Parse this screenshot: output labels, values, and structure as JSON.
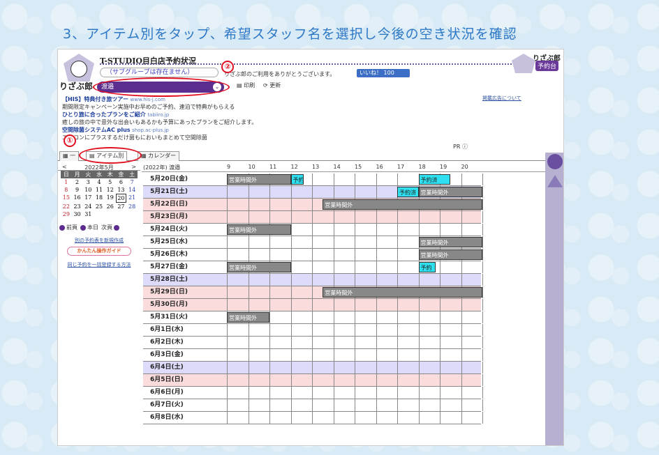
{
  "heading": "3、アイテム別をタップ、希望スタッフ名を選択し今後の空き状況を確認",
  "header": {
    "shop_title": "T-STUDIO目白店予約状況",
    "subgroup_placeholder": "（サブグループは存在ません）",
    "thanks": "りざぶ郎のご利用をありがとうございます。",
    "like_label": "いいね！ 100",
    "logo_text": "りざぶ郎",
    "logo_right_text": "りざぶ郎",
    "logo_right_badge": "予約台"
  },
  "staff_select": {
    "value": "渡邉"
  },
  "toolbar": {
    "print_label": "印刷",
    "refresh_label": "更新"
  },
  "badges": {
    "one": "①",
    "two": "②"
  },
  "ads": [
    {
      "title": "【HIS】特典付き旅ツアー",
      "url": "www.his-j.com",
      "desc": "期間限定キャンペーン実施中お早めのご予約、連泊で特典がもらえる"
    },
    {
      "title": "ひとり旅に合ったプランをご紹介",
      "url": "tabiiro.jp",
      "desc": "癒しの旅の中で意外な出会いもあるかも予算にあったプランをご紹介します。"
    },
    {
      "title": "空間除菌システムAC plus",
      "url": "shop.ac-plus.jp",
      "desc": "エアコンにプラスするだけ菌もにおいもまとめて空間除菌"
    }
  ],
  "ad_info_link": "掲載広告について",
  "pr_label": "PR ⓘ",
  "tabs": [
    {
      "label": "一"
    },
    {
      "label": "アイテム別"
    },
    {
      "label": "カレンダー"
    }
  ],
  "calendar": {
    "prev": "<",
    "month": "2022年5月",
    "next": ">",
    "weekdays": [
      "日",
      "月",
      "火",
      "水",
      "木",
      "金",
      "土"
    ],
    "days": [
      "1",
      "2",
      "3",
      "4",
      "5",
      "6",
      "7",
      "8",
      "9",
      "10",
      "11",
      "12",
      "13",
      "14",
      "15",
      "16",
      "17",
      "18",
      "19",
      "20",
      "21",
      "22",
      "23",
      "24",
      "25",
      "26",
      "27",
      "28",
      "29",
      "30",
      "31"
    ]
  },
  "nav": {
    "prev_label": "前頁",
    "today_label": "本日",
    "next_label": "次頁"
  },
  "side_links": {
    "new_table": "別の予約表を新規作成",
    "guide": "かんたん操作ガイド",
    "bulk": "同じ予約を一括登録する方法"
  },
  "schedule": {
    "caption": "(2022年) 渡邉",
    "hours": [
      "9",
      "10",
      "11",
      "12",
      "13",
      "14",
      "15",
      "16",
      "17",
      "18",
      "19",
      "20"
    ],
    "rows": [
      {
        "label": "5月20日(金)",
        "kind": "weekday",
        "blocks": [
          {
            "text": "営業時間外",
            "start": 9,
            "end": 12,
            "type": "out"
          },
          {
            "text": "予約",
            "start": 12,
            "end": 12.6,
            "type": "booked"
          },
          {
            "text": "予約済",
            "start": 18,
            "end": 19.5,
            "type": "booked"
          }
        ]
      },
      {
        "label": "5月21日(土)",
        "kind": "sat",
        "blocks": [
          {
            "text": "予約済",
            "start": 17,
            "end": 18,
            "type": "booked"
          },
          {
            "text": "営業時間外",
            "start": 18,
            "end": 21,
            "type": "out"
          }
        ]
      },
      {
        "label": "5月22日(日)",
        "kind": "sun",
        "blocks": [
          {
            "text": "営業時間外",
            "start": 13.5,
            "end": 21,
            "type": "out"
          }
        ]
      },
      {
        "label": "5月23日(月)",
        "kind": "sun",
        "blocks": []
      },
      {
        "label": "5月24日(火)",
        "kind": "weekday",
        "blocks": [
          {
            "text": "営業時間外",
            "start": 9,
            "end": 12,
            "type": "out"
          }
        ]
      },
      {
        "label": "5月25日(水)",
        "kind": "weekday",
        "blocks": [
          {
            "text": "営業時間外",
            "start": 18,
            "end": 21,
            "type": "out"
          }
        ]
      },
      {
        "label": "5月26日(木)",
        "kind": "weekday",
        "blocks": [
          {
            "text": "営業時間外",
            "start": 18,
            "end": 21,
            "type": "out"
          }
        ]
      },
      {
        "label": "5月27日(金)",
        "kind": "weekday",
        "blocks": [
          {
            "text": "営業時間外",
            "start": 9,
            "end": 12,
            "type": "out"
          },
          {
            "text": "予約",
            "start": 18,
            "end": 18.8,
            "type": "booked"
          }
        ]
      },
      {
        "label": "5月28日(土)",
        "kind": "sat",
        "blocks": []
      },
      {
        "label": "5月29日(日)",
        "kind": "sun",
        "blocks": [
          {
            "text": "営業時間外",
            "start": 13.5,
            "end": 21,
            "type": "out"
          }
        ]
      },
      {
        "label": "5月30日(月)",
        "kind": "sun",
        "blocks": []
      },
      {
        "label": "5月31日(火)",
        "kind": "weekday",
        "blocks": [
          {
            "text": "営業時間外",
            "start": 9,
            "end": 11,
            "type": "out"
          }
        ]
      },
      {
        "label": "6月1日(水)",
        "kind": "weekday",
        "blocks": []
      },
      {
        "label": "6月2日(木)",
        "kind": "weekday",
        "blocks": []
      },
      {
        "label": "6月3日(金)",
        "kind": "weekday",
        "blocks": []
      },
      {
        "label": "6月4日(土)",
        "kind": "sat",
        "blocks": []
      },
      {
        "label": "6月5日(日)",
        "kind": "sun",
        "blocks": []
      },
      {
        "label": "6月6日(月)",
        "kind": "weekday",
        "blocks": []
      },
      {
        "label": "6月7日(火)",
        "kind": "weekday",
        "blocks": []
      },
      {
        "label": "6月8日(水)",
        "kind": "weekday",
        "blocks": []
      }
    ]
  },
  "colors": {
    "weekday": "#ffffff",
    "sat": "#dcdcfa",
    "sun": "#fadcdc",
    "booked": "#2ee0f0",
    "out": "#888888",
    "brand": "#5b2d8e",
    "annotation": "#e01020"
  }
}
